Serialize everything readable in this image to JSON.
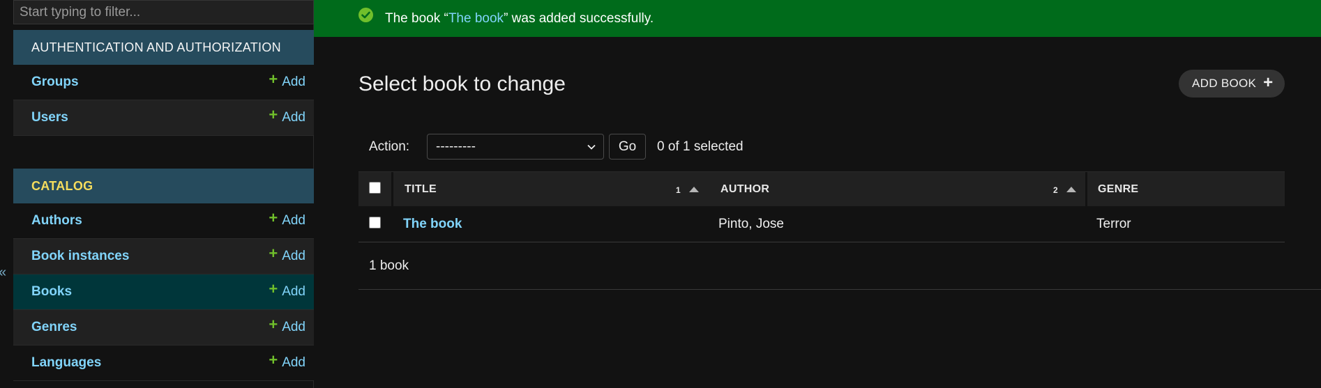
{
  "sidebar": {
    "filter_placeholder": "Start typing to filter...",
    "collapse_glyph": "«",
    "modules": [
      {
        "caption": "AUTHENTICATION AND AUTHORIZATION",
        "models": [
          {
            "name": "Groups",
            "add": "Add"
          },
          {
            "name": "Users",
            "add": "Add"
          }
        ]
      },
      {
        "caption": "CATALOG",
        "models": [
          {
            "name": "Authors",
            "add": "Add"
          },
          {
            "name": "Book instances",
            "add": "Add"
          },
          {
            "name": "Books",
            "add": "Add",
            "current": true
          },
          {
            "name": "Genres",
            "add": "Add"
          },
          {
            "name": "Languages",
            "add": "Add"
          }
        ]
      }
    ]
  },
  "message": {
    "prefix": "The book “",
    "link": "The book",
    "suffix": "” was added successfully."
  },
  "content": {
    "title": "Select book to change",
    "add_button": "ADD BOOK"
  },
  "actions": {
    "label": "Action:",
    "selected_option": "---------",
    "go": "Go",
    "counter": "0 of 1 selected"
  },
  "table": {
    "columns": [
      {
        "label": "TITLE",
        "sort_priority": "1"
      },
      {
        "label": "AUTHOR",
        "sort_priority": "2"
      },
      {
        "label": "GENRE",
        "sort_priority": ""
      }
    ],
    "rows": [
      {
        "title": "The book",
        "author": "Pinto, Jose",
        "genre": "Terror"
      }
    ]
  },
  "paginator": {
    "text": "1 book"
  },
  "colors": {
    "banner": "#006b1b",
    "module_caption": "#264b5d",
    "link": "#81d4fa",
    "add_plus": "#70bf2b",
    "current_row": "#00363a"
  }
}
